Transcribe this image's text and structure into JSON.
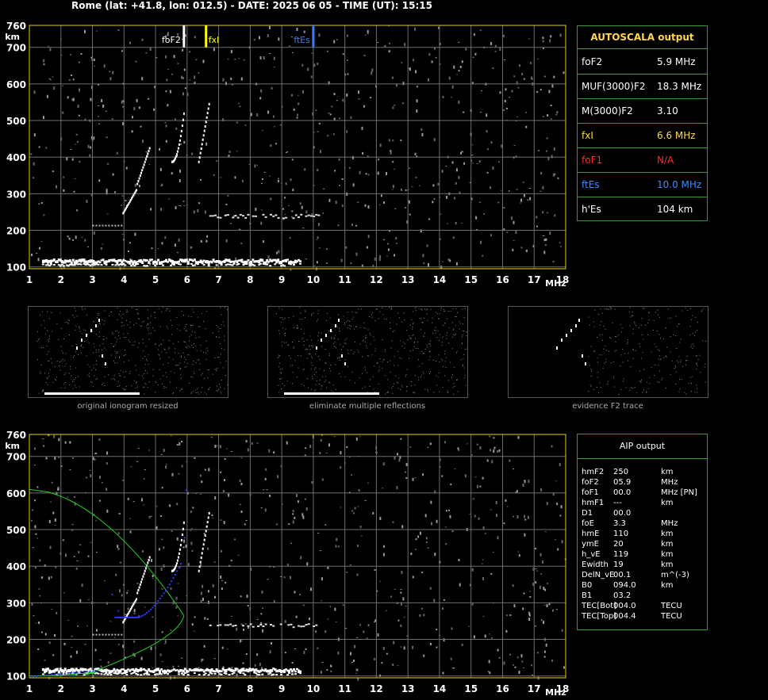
{
  "header": {
    "title": "Rome (lat: +41.8, lon: 012.5) - DATE: 2025 06 05 - TIME (UT): 15:15"
  },
  "chart_data": [
    {
      "type": "scatter",
      "title": "",
      "xlabel": "MHz",
      "ylabel": "km",
      "xlim": [
        1,
        18
      ],
      "ylim": [
        95,
        760
      ],
      "x_ticks": [
        "1",
        "2",
        "3",
        "4",
        "5",
        "6",
        "7",
        "8",
        "9",
        "10",
        "11",
        "12",
        "13",
        "14",
        "15",
        "16",
        "17",
        "18"
      ],
      "y_ticks": [
        "100",
        "200",
        "300",
        "400",
        "500",
        "600",
        "700",
        "760"
      ],
      "markers": [
        {
          "label": "foF2",
          "x": 5.9,
          "color": "#ffffff"
        },
        {
          "label": "fxI",
          "x": 6.6,
          "color": "#ffff00"
        },
        {
          "label": "ftEs",
          "x": 10.0,
          "color": "#3a7bff"
        }
      ]
    },
    {
      "type": "scatter",
      "title": "",
      "xlabel": "MHz",
      "ylabel": "km",
      "xlim": [
        1,
        18
      ],
      "ylim": [
        95,
        760
      ],
      "x_ticks": [
        "1",
        "2",
        "3",
        "4",
        "5",
        "6",
        "7",
        "8",
        "9",
        "10",
        "11",
        "12",
        "13",
        "14",
        "15",
        "16",
        "17",
        "18"
      ],
      "y_ticks": [
        "100",
        "200",
        "300",
        "400",
        "500",
        "600",
        "700",
        "760"
      ]
    }
  ],
  "autoscala": {
    "title": "AUTOSCALA output",
    "rows": [
      {
        "key": "foF2",
        "value": "5.9  MHz",
        "color": "#ffffff"
      },
      {
        "key": "MUF(3000)F2",
        "value": "18.3 MHz",
        "color": "#ffffff"
      },
      {
        "key": "M(3000)F2",
        "value": "3.10",
        "color": "#ffffff"
      },
      {
        "key": "fxI",
        "value": "6.6 MHz",
        "color": "#ffd84a"
      },
      {
        "key": "foF1",
        "value": "N/A",
        "color": "#ff2a2a"
      },
      {
        "key": "ftEs",
        "value": "10.0 MHz",
        "color": "#3a8bff"
      },
      {
        "key": "h'Es",
        "value": "104     km",
        "color": "#ffffff"
      }
    ]
  },
  "thumbnails": [
    {
      "caption": "original ionogram resized"
    },
    {
      "caption": "eliminate multiple reflections"
    },
    {
      "caption": "evidence F2 trace"
    }
  ],
  "aip": {
    "title": "AIP output",
    "rows": [
      {
        "k": "hmF2",
        "v": "250",
        "u": "km"
      },
      {
        "k": "foF2",
        "v": "05.9",
        "u": "MHz"
      },
      {
        "k": "foF1",
        "v": "00.0",
        "u": "MHz    [PN]"
      },
      {
        "k": "hmF1",
        "v": "---",
        "u": "km"
      },
      {
        "k": "D1",
        "v": "00.0",
        "u": ""
      },
      {
        "k": "foE",
        "v": "3.3",
        "u": "MHz"
      },
      {
        "k": "hmE",
        "v": "110",
        "u": "km"
      },
      {
        "k": "ymE",
        "v": "20",
        "u": "km"
      },
      {
        "k": "h_vE",
        "v": "119",
        "u": "km"
      },
      {
        "k": "Ewidth",
        "v": "19",
        "u": "km"
      },
      {
        "k": "DelN_vE",
        "v": "00.1",
        "u": "m^(-3)"
      },
      {
        "k": "B0",
        "v": "094.0",
        "u": "km"
      },
      {
        "k": "B1",
        "v": "03.2",
        "u": ""
      },
      {
        "k": "TEC[Bot]",
        "v": "004.0",
        "u": "TECU"
      },
      {
        "k": "TEC[Top]",
        "v": "004.4",
        "u": "TECU"
      }
    ]
  }
}
